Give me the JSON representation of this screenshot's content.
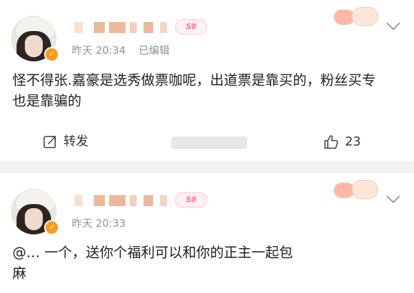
{
  "posts": [
    {
      "time": "昨天 20:34",
      "edited": "已编辑",
      "level": "S8",
      "text_line1": "怪不得张.嘉豪是选秀做票咖呢，出道票是靠买的，粉丝买专",
      "text_line2": "也是靠骗的",
      "repost_label": "转发",
      "like_count": "23"
    },
    {
      "time": "昨天 20:33",
      "level": "S8",
      "text_line1": "@… 一个，送你个福利可以和你的正主一起包",
      "text_line2": "麻"
    }
  ],
  "icons": {
    "verify": "verified-badge-icon",
    "more": "chevron-down-icon",
    "repost": "repost-icon",
    "like": "thumbs-up-icon"
  },
  "colors": {
    "verify": "#ff9a1a",
    "meta": "#939393",
    "level": "#ff6f92"
  }
}
